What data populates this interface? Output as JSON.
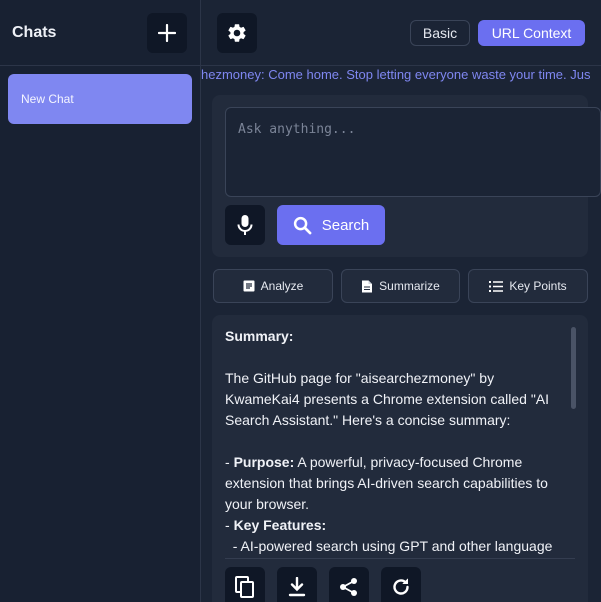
{
  "sidebar": {
    "title": "Chats",
    "new_chat_icon": "plus-icon",
    "items": [
      {
        "label": "New Chat",
        "active": true
      }
    ]
  },
  "topbar": {
    "settings_icon": "gear-icon",
    "modes": [
      {
        "label": "Basic",
        "active": false
      },
      {
        "label": "URL Context",
        "active": true
      }
    ]
  },
  "ticker": {
    "text": "hezmoney: Come home. Stop letting everyone waste your time. Jus"
  },
  "search": {
    "placeholder": "Ask anything...",
    "value": "",
    "mic_icon": "microphone-icon",
    "button_label": "Search",
    "button_icon": "search-icon"
  },
  "actions": [
    {
      "label": "Analyze",
      "icon": "document-icon"
    },
    {
      "label": "Summarize",
      "icon": "file-icon"
    },
    {
      "label": "Key Points",
      "icon": "list-icon"
    }
  ],
  "result": {
    "heading": "Summary:",
    "intro": "The GitHub page for \"aisearchezmoney\" by KwameKai4 presents a Chrome extension called \"AI Search Assistant.\" Here's a concise summary:",
    "purpose_label": "Purpose:",
    "purpose_text": " A powerful, privacy-focused Chrome extension that brings AI-driven search capabilities to your browser.",
    "features_label": "Key Features:",
    "feature_1": "  - AI-powered search using GPT and other language"
  },
  "tools": [
    "copy-icon",
    "download-icon",
    "share-icon",
    "refresh-icon"
  ],
  "colors": {
    "accent": "#6b6ff0",
    "active_chat": "#7f87f1",
    "background": "#1b2435",
    "card": "#222b3c"
  }
}
